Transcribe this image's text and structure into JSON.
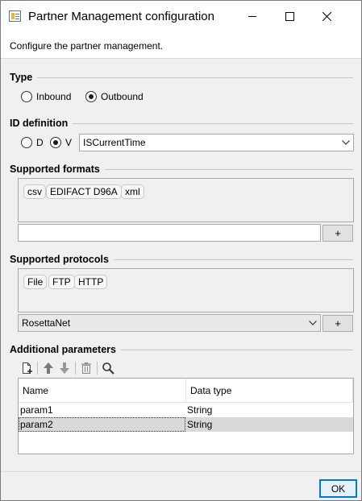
{
  "window": {
    "title": "Partner Management configuration",
    "description": "Configure the partner management."
  },
  "type_group": {
    "header": "Type",
    "options": [
      {
        "label": "Inbound",
        "checked": false
      },
      {
        "label": "Outbound",
        "checked": true
      }
    ]
  },
  "id_group": {
    "header": "ID definition",
    "options": [
      {
        "label": "D",
        "checked": false
      },
      {
        "label": "V",
        "checked": true
      }
    ],
    "value_select": "ISCurrentTime"
  },
  "formats_group": {
    "header": "Supported formats",
    "chips": [
      "csv",
      "EDIFACT D96A",
      "xml"
    ],
    "input_value": "",
    "add_label": "+"
  },
  "protocols_group": {
    "header": "Supported protocols",
    "chips": [
      "File",
      "FTP",
      "HTTP"
    ],
    "select_value": "RosettaNet",
    "add_label": "+"
  },
  "params_group": {
    "header": "Additional parameters",
    "toolbar": [
      "new-param-icon",
      "move-up-icon",
      "move-down-icon",
      "delete-icon",
      "search-icon"
    ],
    "columns": [
      "Name",
      "Data type"
    ],
    "rows": [
      {
        "name": "param1",
        "type": "String",
        "selected": false
      },
      {
        "name": "param2",
        "type": "String",
        "selected": true
      }
    ]
  },
  "footer": {
    "ok_label": "OK"
  },
  "colors": {
    "accent": "#0078d7",
    "selected_row": "#d9d9d9",
    "dialog_bg": "#f0f0f0"
  }
}
